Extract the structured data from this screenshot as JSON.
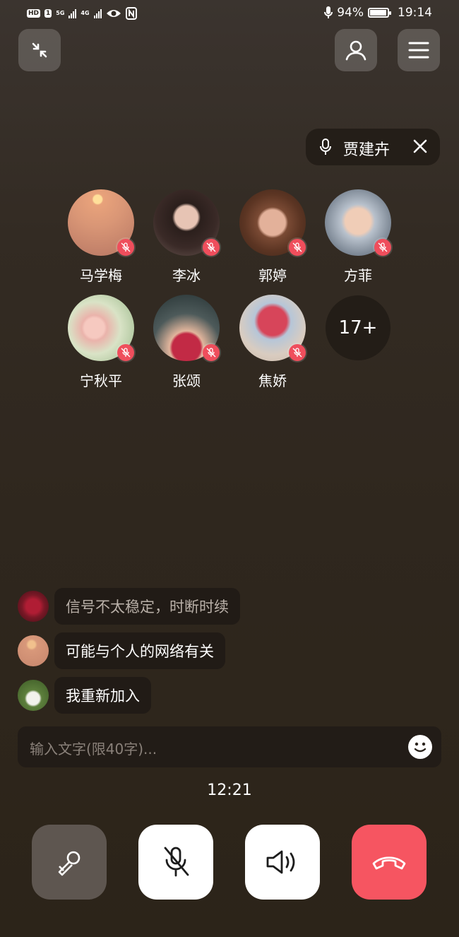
{
  "status_bar": {
    "battery": "94%",
    "time": "19:14"
  },
  "top": {
    "minimize_icon": "minimize-icon",
    "contacts_icon": "person-icon",
    "menu_icon": "menu-icon"
  },
  "speaker": {
    "name": "贾建卉"
  },
  "members": [
    {
      "name": "马学梅"
    },
    {
      "name": "李冰"
    },
    {
      "name": "郭婷"
    },
    {
      "name": "方菲"
    },
    {
      "name": "宁秋平"
    },
    {
      "name": "张颂"
    },
    {
      "name": "焦娇"
    }
  ],
  "more_count": "17+",
  "chat": [
    {
      "text": "信号不太稳定，时断时续"
    },
    {
      "text": "可能与个人的网络有关"
    },
    {
      "text": "我重新加入"
    }
  ],
  "input": {
    "placeholder": "输入文字(限40字)..."
  },
  "call_timer": "12:21",
  "controls": {
    "accent_end": "#f65561"
  }
}
